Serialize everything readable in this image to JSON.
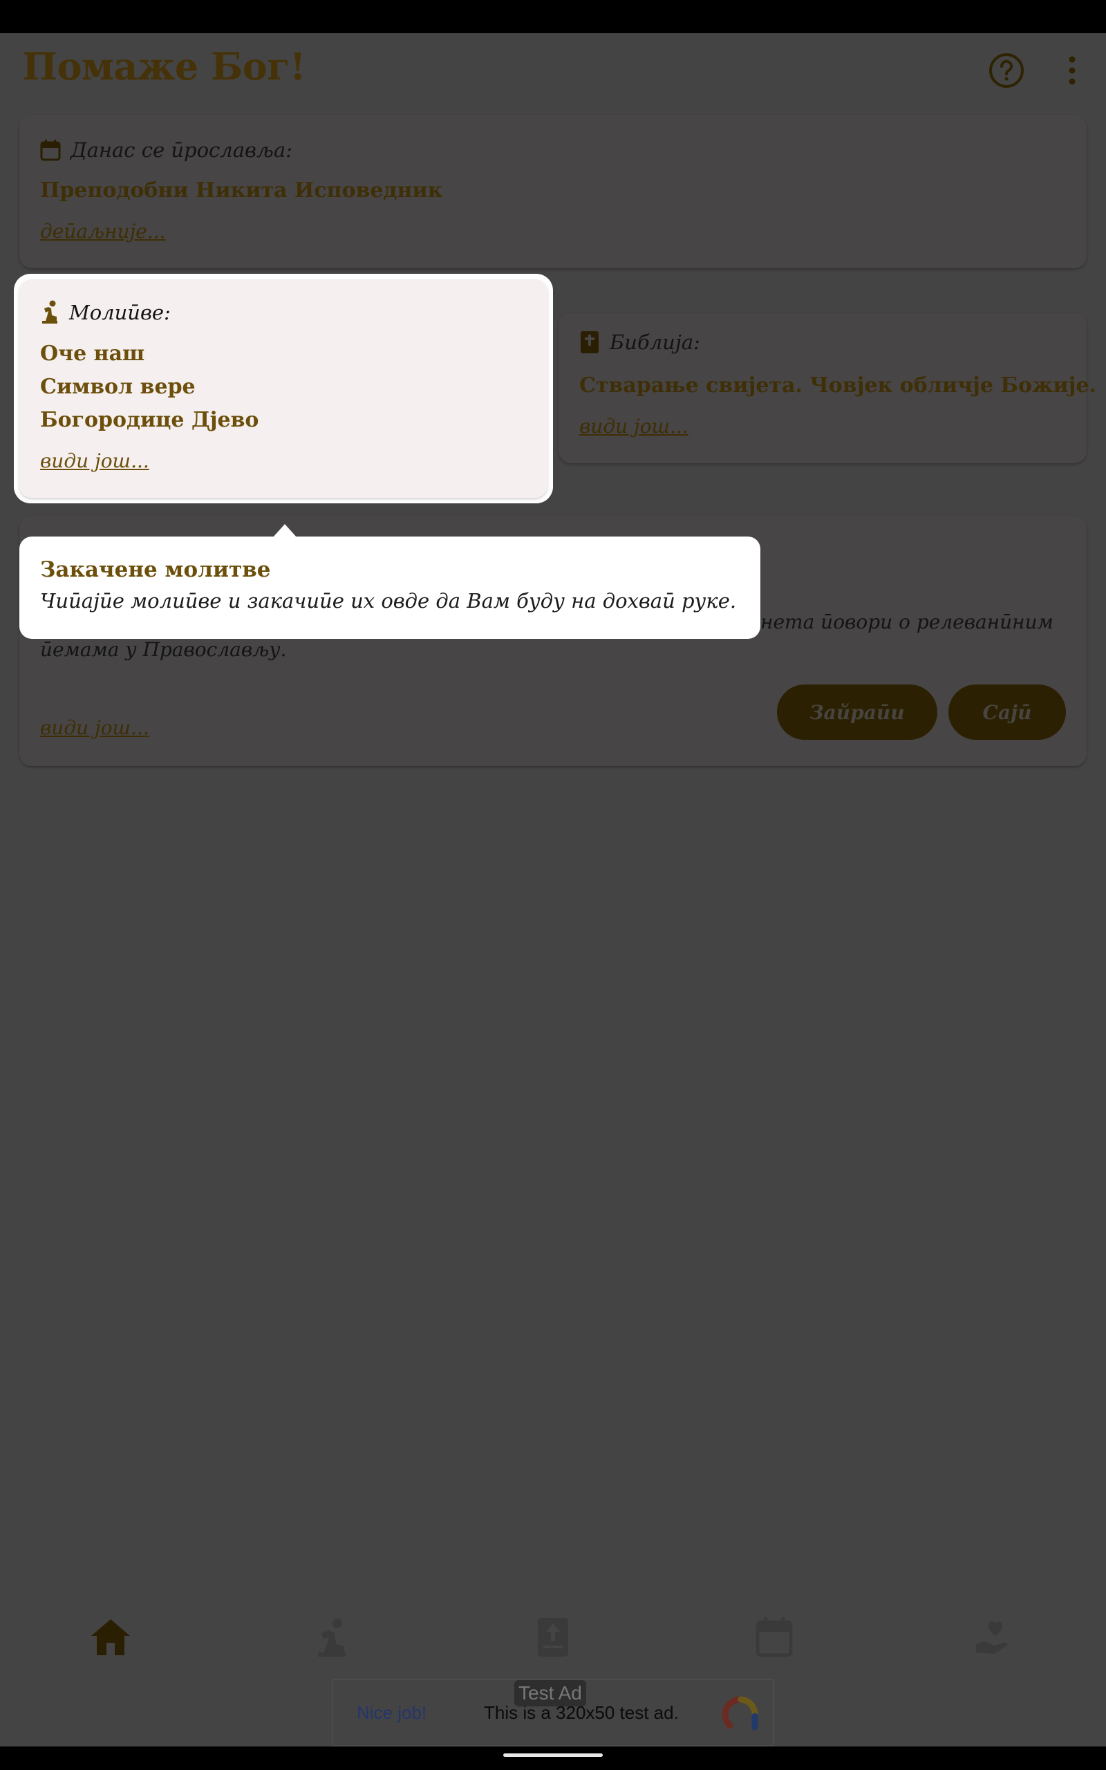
{
  "app": {
    "title": "Помаже Бог!"
  },
  "toolbar": {
    "help_icon": "help-circle-icon",
    "more_icon": "more-vert-icon"
  },
  "today_card": {
    "icon": "calendar-icon",
    "label": "Данас се ӣрославља:",
    "saint": "Преподобни Никита Исповедник",
    "link": "деӣаљније..."
  },
  "prayers_card": {
    "icon": "praying-person-icon",
    "label": "Молиӣве:",
    "items": [
      "Оче наш",
      "Символ вере",
      "Богородице Дјево"
    ],
    "link": "види још..."
  },
  "bible_card": {
    "icon": "bible-book-icon",
    "label": "Библија:",
    "title": "Стварање свијета. Човјек обличје Божије.",
    "link": "види још..."
  },
  "podcast_card": {
    "text_line1": "нета ӣовори о релеванӣним",
    "text_line2": "ӣемама у Православљу.",
    "link": "види још...",
    "buttons": [
      "Зайраӣи",
      "Сајӣ"
    ]
  },
  "tooltip": {
    "title": "Закачене молитве",
    "body": "Чиӣајӣе молиӣве и закачиӣе их овде да Вам буду на дохваӣ руке."
  },
  "bottom_nav": {
    "items": [
      {
        "icon": "home-icon",
        "active": true
      },
      {
        "icon": "praying-person-icon",
        "active": false
      },
      {
        "icon": "bible-book-icon",
        "active": false
      },
      {
        "icon": "calendar-icon",
        "active": false
      },
      {
        "icon": "hand-heart-icon",
        "active": false
      }
    ]
  },
  "ad": {
    "badge": "Test Ad",
    "nice": "Nice job!",
    "text": "This is a 320x50 test ad."
  },
  "colors": {
    "accent": "#6b4f0b",
    "accent_dim": "#3f2f06",
    "scrim_bg": "#444444",
    "highlight_bg": "#f6efef"
  }
}
